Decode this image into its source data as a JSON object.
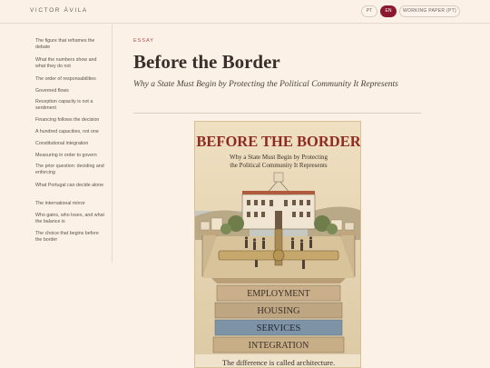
{
  "header": {
    "brand": "VICTOR ÁVILA",
    "lang_pt": "PT",
    "lang_en": "EN",
    "working_paper": "WORKING PAPER (PT)"
  },
  "toc": [
    "The figure that reframes the debate",
    "What the numbers show and what they do not",
    "The order of responsabilities",
    "Governed flows",
    "Reception capacity is not a sentiment",
    "Financing follows the decision",
    "A hundred capacities, not one",
    "Constitutional integration",
    "Measuring in order to govern",
    "The prior question: deciding and enforcing",
    "What Portugal can decide alone",
    "The international mirror",
    "Who gains, who loses, and what the balance is",
    "The choice that begins before the border"
  ],
  "article": {
    "kicker": "ESSAY",
    "title": "Before the Border",
    "subtitle": "Why a State Must Begin by Protecting the Political Community It Represents"
  },
  "poster": {
    "title": "BEFORE THE BORDER",
    "subtitle_line1": "Why a State Must Begin by Protecting",
    "subtitle_line2": "the Political Community It Represents",
    "bands": [
      "EMPLOYMENT",
      "HOUSING",
      "SERVICES",
      "INTEGRATION"
    ],
    "footer": "The difference is called architecture.",
    "colors": {
      "title_red": "#8e2a22",
      "band_stone": "#c9b08a",
      "band_blue": "#7f93a6"
    }
  }
}
